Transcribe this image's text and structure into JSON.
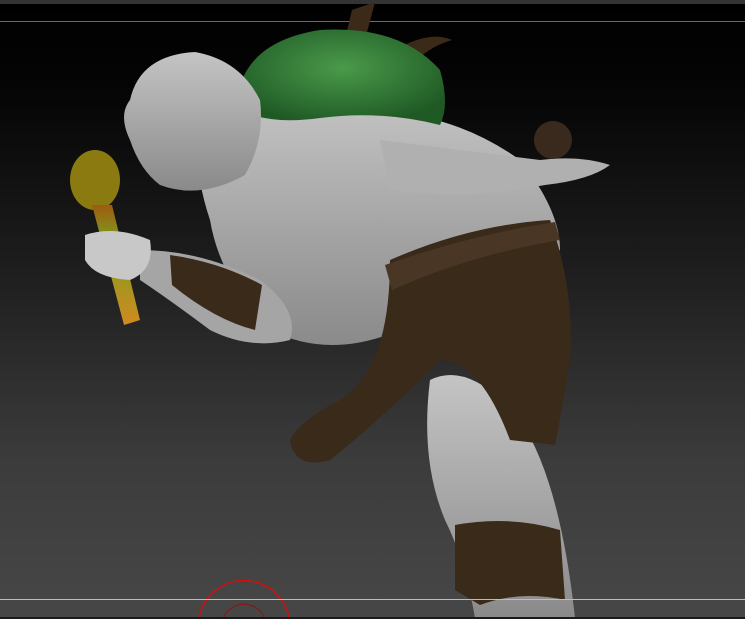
{
  "viewport": {
    "background_top": "#000000",
    "background_bottom": "#474747",
    "model_colors": {
      "skin": "#a8a8a8",
      "moss": "#2f7a35",
      "cloth": "#3a2a1a",
      "staff": "#b59a1c",
      "cursor": "#d01010"
    }
  }
}
